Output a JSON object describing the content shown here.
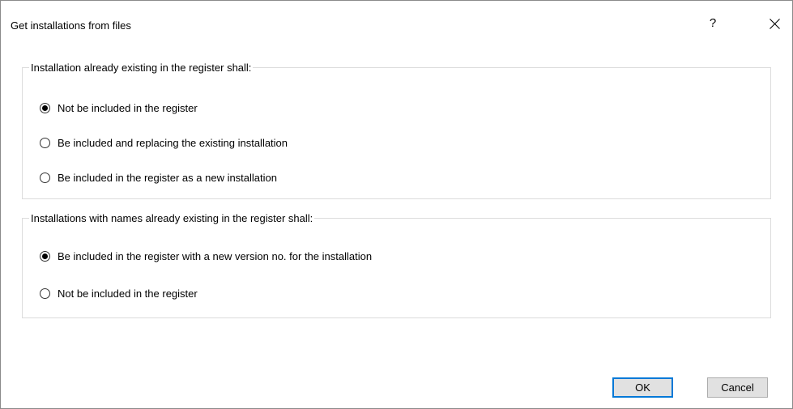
{
  "dialog": {
    "title": "Get installations from files",
    "help_icon": "?",
    "close_icon": "close-icon"
  },
  "group_existing_installation": {
    "legend": "Installation already existing in the register shall:",
    "options": [
      {
        "label": "Not be included in the register",
        "checked": true
      },
      {
        "label": "Be included and replacing the existing installation",
        "checked": false
      },
      {
        "label": "Be included in the register as a new installation",
        "checked": false
      }
    ]
  },
  "group_existing_names": {
    "legend": "Installations with names already existing in the register shall:",
    "options": [
      {
        "label": "Be included in the register with a new version no. for the installation",
        "checked": true
      },
      {
        "label": "Not be included in the register",
        "checked": false
      }
    ]
  },
  "buttons": {
    "ok_label": "OK",
    "cancel_label": "Cancel"
  },
  "colors": {
    "default_button_border": "#0078d7",
    "button_face": "#e1e1e1",
    "group_border": "#dcdcdc"
  }
}
